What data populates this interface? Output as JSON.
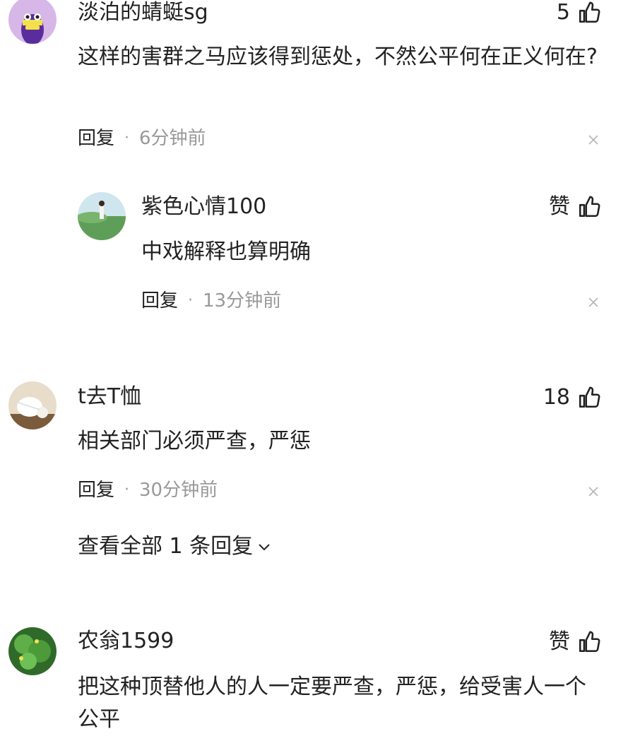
{
  "comments": [
    {
      "username": "淡泊的蜻蜓sg",
      "likes": "5",
      "text": "这样的害群之马应该得到惩处，不然公平何在正义何在?",
      "reply_label": "回复",
      "separator": "·",
      "time": "6分钟前",
      "avatar_icon": "purple-character-avatar"
    },
    {
      "username": "紫色心情100",
      "likes": "赞",
      "text": "中戏解释也算明确",
      "reply_label": "回复",
      "separator": "·",
      "time": "13分钟前",
      "avatar_icon": "scenery-avatar"
    },
    {
      "username": "t去T恤",
      "likes": "18",
      "text": "相关部门必须严查，严惩",
      "reply_label": "回复",
      "separator": "·",
      "time": "30分钟前",
      "avatar_icon": "shuttlecock-avatar",
      "view_all_label": "查看全部 1 条回复"
    },
    {
      "username": "农翁1599",
      "likes": "赞",
      "text": "把这种顶替他人的人一定要严查，严惩，给受害人一个公平",
      "avatar_icon": "green-plant-avatar"
    }
  ],
  "icons": {
    "like": "thumbs-up-icon",
    "close": "close-icon",
    "expand": "chevron-down-icon"
  },
  "colors": {
    "text": "#222222",
    "muted": "#999999",
    "background": "#ffffff"
  }
}
